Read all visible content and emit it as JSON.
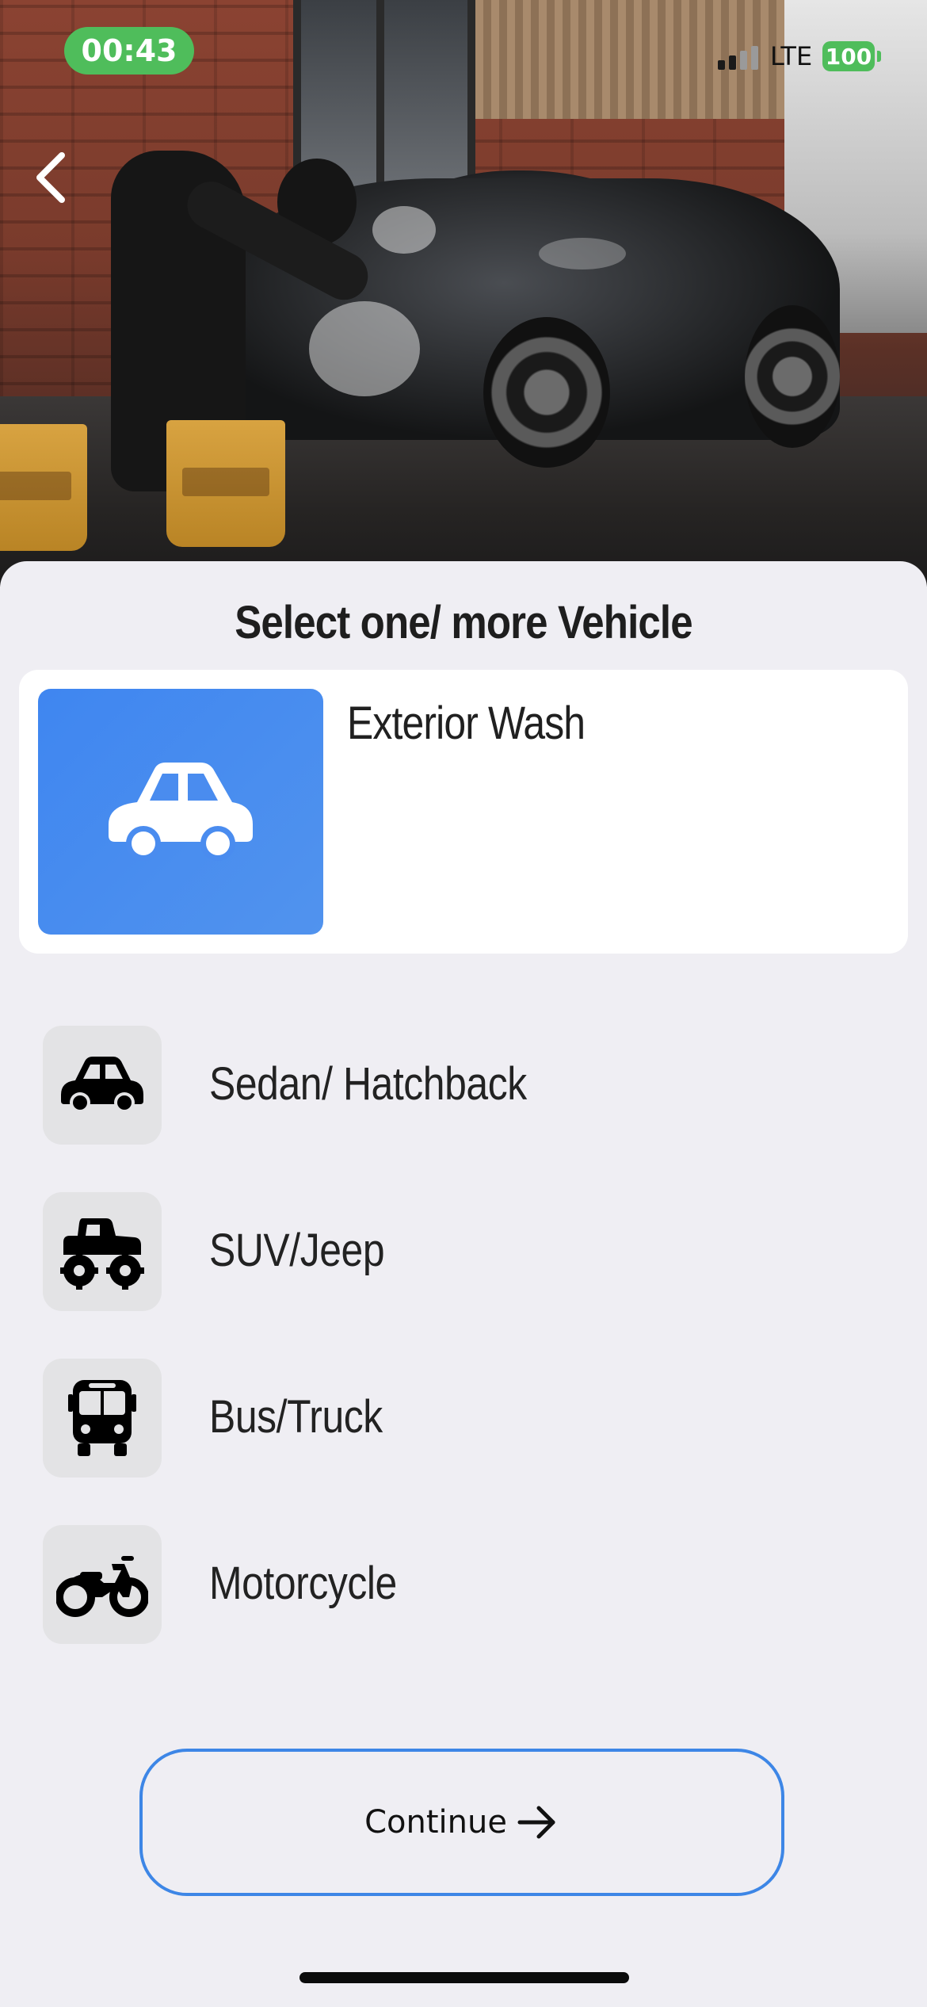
{
  "status_bar": {
    "time": "00:43",
    "network": "LTE",
    "battery": "100"
  },
  "sheet": {
    "title": "Select one/ more Vehicle",
    "service": {
      "name": "Exterior Wash",
      "icon": "car-icon",
      "thumb_color": "#4a8cef"
    },
    "vehicles": [
      {
        "label": "Sedan/ Hatchback",
        "icon": "sedan-icon"
      },
      {
        "label": "SUV/Jeep",
        "icon": "monster-truck-icon"
      },
      {
        "label": "Bus/Truck",
        "icon": "bus-icon"
      },
      {
        "label": "Motorcycle",
        "icon": "motorcycle-icon"
      }
    ],
    "continue_label": "Continue"
  },
  "colors": {
    "accent": "#3d86e6",
    "status_green": "#4fbd5b",
    "background": "#efeef3"
  }
}
